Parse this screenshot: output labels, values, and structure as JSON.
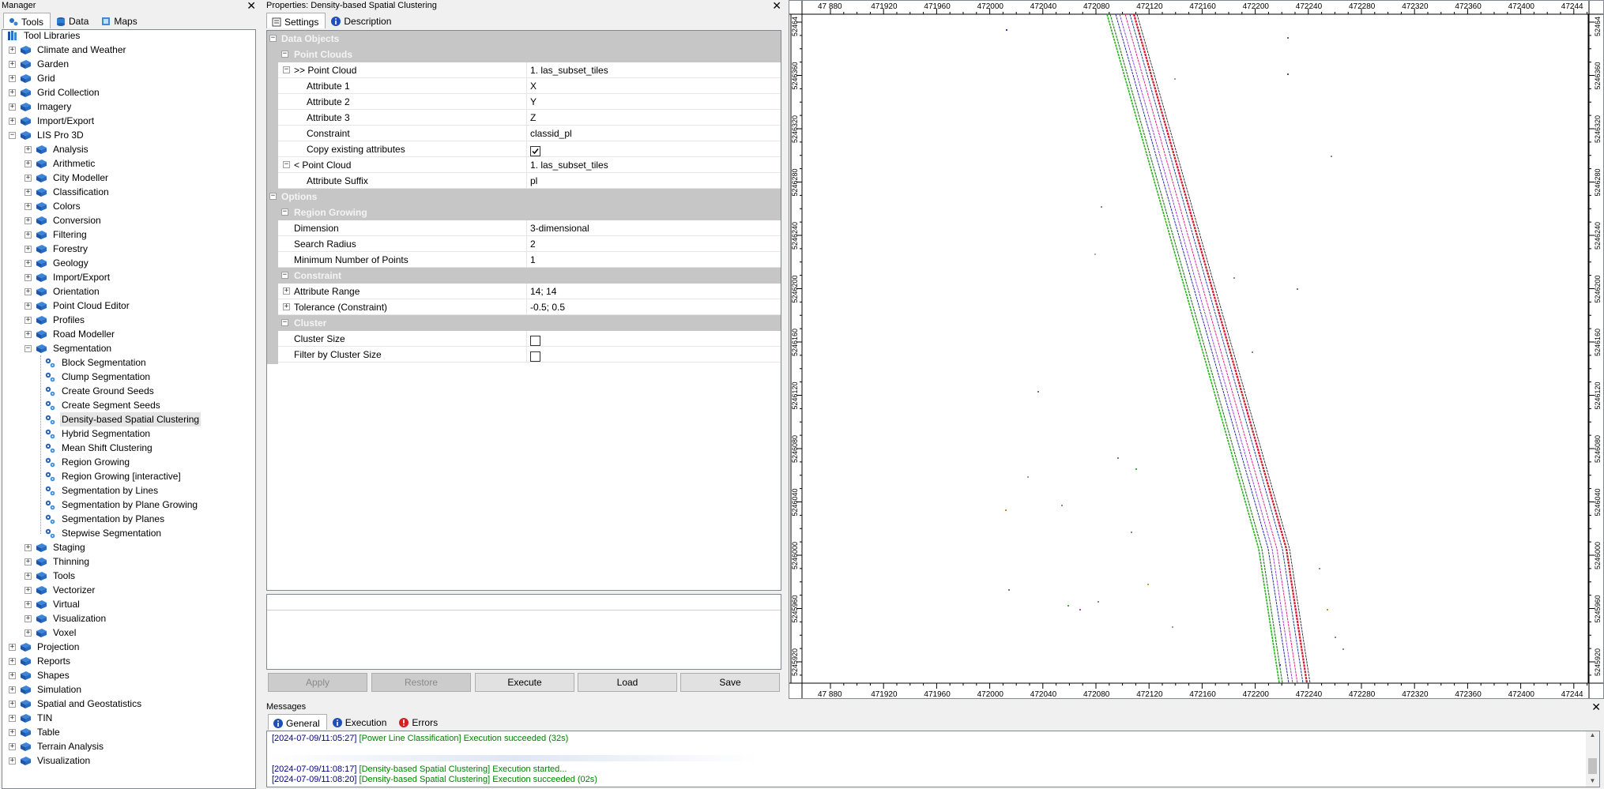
{
  "manager": {
    "title": "Manager",
    "tabs": [
      "Tools",
      "Data",
      "Maps"
    ],
    "tree": [
      {
        "label": "Tool Libraries",
        "level": 0,
        "type": "root",
        "y": 44
      },
      {
        "label": "Climate and Weather",
        "level": 1,
        "exp": "+",
        "y": 62
      },
      {
        "label": "Garden",
        "level": 1,
        "exp": "+",
        "y": 80
      },
      {
        "label": "Grid",
        "level": 1,
        "exp": "+",
        "y": 98
      },
      {
        "label": "Grid Collection",
        "level": 1,
        "exp": "+",
        "y": 116
      },
      {
        "label": "Imagery",
        "level": 1,
        "exp": "+",
        "y": 134
      },
      {
        "label": "Import/Export",
        "level": 1,
        "exp": "+",
        "y": 152
      },
      {
        "label": "LIS Pro 3D",
        "level": 1,
        "exp": "-",
        "y": 170
      },
      {
        "label": "Analysis",
        "level": 2,
        "exp": "+",
        "y": 188
      },
      {
        "label": "Arithmetic",
        "level": 2,
        "exp": "+",
        "y": 206
      },
      {
        "label": "City Modeller",
        "level": 2,
        "exp": "+",
        "y": 224
      },
      {
        "label": "Classification",
        "level": 2,
        "exp": "+",
        "y": 242
      },
      {
        "label": "Colors",
        "level": 2,
        "exp": "+",
        "y": 260
      },
      {
        "label": "Conversion",
        "level": 2,
        "exp": "+",
        "y": 278
      },
      {
        "label": "Filtering",
        "level": 2,
        "exp": "+",
        "y": 296
      },
      {
        "label": "Forestry",
        "level": 2,
        "exp": "+",
        "y": 314
      },
      {
        "label": "Geology",
        "level": 2,
        "exp": "+",
        "y": 332
      },
      {
        "label": "Import/Export",
        "level": 2,
        "exp": "+",
        "y": 350
      },
      {
        "label": "Orientation",
        "level": 2,
        "exp": "+",
        "y": 368
      },
      {
        "label": "Point Cloud Editor",
        "level": 2,
        "exp": "+",
        "y": 386
      },
      {
        "label": "Profiles",
        "level": 2,
        "exp": "+",
        "y": 404
      },
      {
        "label": "Road Modeller",
        "level": 2,
        "exp": "+",
        "y": 422
      },
      {
        "label": "Segmentation",
        "level": 2,
        "exp": "-",
        "y": 440
      },
      {
        "label": "Block Segmentation",
        "level": 3,
        "type": "tool",
        "y": 458
      },
      {
        "label": "Clump Segmentation",
        "level": 3,
        "type": "tool",
        "y": 476
      },
      {
        "label": "Create Ground Seeds",
        "level": 3,
        "type": "tool",
        "y": 494
      },
      {
        "label": "Create Segment Seeds",
        "level": 3,
        "type": "tool",
        "y": 512
      },
      {
        "label": "Density-based Spatial Clustering",
        "level": 3,
        "type": "tool",
        "sel": true,
        "y": 530
      },
      {
        "label": "Hybrid Segmentation",
        "level": 3,
        "type": "tool",
        "y": 548
      },
      {
        "label": "Mean Shift Clustering",
        "level": 3,
        "type": "tool",
        "y": 566
      },
      {
        "label": "Region Growing",
        "level": 3,
        "type": "tool",
        "y": 584
      },
      {
        "label": "Region Growing [interactive]",
        "level": 3,
        "type": "tool",
        "y": 602
      },
      {
        "label": "Segmentation by Lines",
        "level": 3,
        "type": "tool",
        "y": 620
      },
      {
        "label": "Segmentation by Plane Growing",
        "level": 3,
        "type": "tool",
        "y": 638
      },
      {
        "label": "Segmentation by Planes",
        "level": 3,
        "type": "tool",
        "y": 656
      },
      {
        "label": "Stepwise Segmentation",
        "level": 3,
        "type": "tool",
        "y": 674
      },
      {
        "label": "Staging",
        "level": 2,
        "exp": "+",
        "y": 692
      },
      {
        "label": "Thinning",
        "level": 2,
        "exp": "+",
        "y": 710
      },
      {
        "label": "Tools",
        "level": 2,
        "exp": "+",
        "y": 728
      },
      {
        "label": "Vectorizer",
        "level": 2,
        "exp": "+",
        "y": 746
      },
      {
        "label": "Virtual",
        "level": 2,
        "exp": "+",
        "y": 764
      },
      {
        "label": "Visualization",
        "level": 2,
        "exp": "+",
        "y": 782
      },
      {
        "label": "Voxel",
        "level": 2,
        "exp": "+",
        "y": 800
      },
      {
        "label": "Projection",
        "level": 1,
        "exp": "+",
        "y": 818
      },
      {
        "label": "Reports",
        "level": 1,
        "exp": "+",
        "y": 836
      },
      {
        "label": "Shapes",
        "level": 1,
        "exp": "+",
        "y": 854
      },
      {
        "label": "Simulation",
        "level": 1,
        "exp": "+",
        "y": 872
      },
      {
        "label": "Spatial and Geostatistics",
        "level": 1,
        "exp": "+",
        "y": 890
      },
      {
        "label": "TIN",
        "level": 1,
        "exp": "+",
        "y": 908
      },
      {
        "label": "Table",
        "level": 1,
        "exp": "+",
        "y": 926
      },
      {
        "label": "Terrain Analysis",
        "level": 1,
        "exp": "+",
        "y": 944
      },
      {
        "label": "Visualization",
        "level": 1,
        "exp": "+",
        "y": 962
      }
    ]
  },
  "properties": {
    "title": "Properties: Density-based Spatial Clustering",
    "tabs": [
      "Settings",
      "Description"
    ],
    "rows": [
      {
        "kind": "cat",
        "indent": 0,
        "label": "Data Objects",
        "y": 48
      },
      {
        "kind": "cat",
        "indent": 1,
        "label": "Point Clouds",
        "y": 68
      },
      {
        "kind": "prop",
        "indent": 1,
        "exp": "-",
        "label": ">> Point Cloud",
        "value": "1. las_subset_tiles",
        "y": 88
      },
      {
        "kind": "prop",
        "indent": 2,
        "label": "Attribute 1",
        "value": "X",
        "y": 108
      },
      {
        "kind": "prop",
        "indent": 2,
        "label": "Attribute 2",
        "value": "Y",
        "y": 128
      },
      {
        "kind": "prop",
        "indent": 2,
        "label": "Attribute 3",
        "value": "Z",
        "y": 148
      },
      {
        "kind": "prop",
        "indent": 2,
        "label": "Constraint",
        "value": "classid_pl",
        "y": 168
      },
      {
        "kind": "check",
        "indent": 2,
        "label": "Copy existing attributes",
        "checked": true,
        "y": 188
      },
      {
        "kind": "prop",
        "indent": 1,
        "exp": "-",
        "label": "< Point Cloud",
        "value": "1. las_subset_tiles",
        "y": 208
      },
      {
        "kind": "prop",
        "indent": 2,
        "label": "Attribute Suffix",
        "value": "pl",
        "y": 228
      },
      {
        "kind": "cat",
        "indent": 0,
        "label": "Options",
        "y": 248
      },
      {
        "kind": "cat",
        "indent": 1,
        "label": "Region Growing",
        "y": 268
      },
      {
        "kind": "prop",
        "indent": 1,
        "label": "Dimension",
        "value": "3-dimensional",
        "y": 288
      },
      {
        "kind": "prop",
        "indent": 1,
        "label": "Search Radius",
        "value": "2",
        "y": 308
      },
      {
        "kind": "prop",
        "indent": 1,
        "label": "Minimum Number of Points",
        "value": "1",
        "y": 328
      },
      {
        "kind": "cat",
        "indent": 1,
        "label": "Constraint",
        "y": 348
      },
      {
        "kind": "prop",
        "indent": 1,
        "exp": "+",
        "label": "Attribute Range",
        "value": "14; 14",
        "y": 368
      },
      {
        "kind": "prop",
        "indent": 1,
        "exp": "+",
        "label": "Tolerance (Constraint)",
        "value": "-0.5; 0.5",
        "y": 388
      },
      {
        "kind": "cat",
        "indent": 1,
        "label": "Cluster",
        "y": 408
      },
      {
        "kind": "check",
        "indent": 1,
        "label": "Cluster Size",
        "checked": false,
        "y": 428
      },
      {
        "kind": "check",
        "indent": 1,
        "label": "Filter by Cluster Size",
        "checked": false,
        "y": 448
      }
    ],
    "buttons": {
      "apply": "Apply",
      "restore": "Restore",
      "execute": "Execute",
      "load": "Load",
      "save": "Save"
    }
  },
  "map": {
    "x_ticks": [
      "47 880",
      "471920",
      "471960",
      "472000",
      "472040",
      "472080",
      "472120",
      "472160",
      "472200",
      "472240",
      "472280",
      "472320",
      "472360",
      "472400",
      "47244"
    ],
    "y_ticks": [
      "52464",
      "5246360",
      "5246320",
      "5246280",
      "5246240",
      "5246200",
      "5246160",
      "5246120",
      "5246080",
      "5246040",
      "5246000",
      "5245960",
      "5245920"
    ]
  },
  "messages": {
    "title": "Messages",
    "tabs": [
      "General",
      "Execution",
      "Errors"
    ],
    "lines": [
      {
        "ts": "[2024-07-09/11:05:27]",
        "text": "[Power Line Classification] Execution succeeded (32s)"
      },
      {
        "ts": "[2024-07-09/11:08:17]",
        "text": "[Density-based Spatial Clustering] Execution started..."
      },
      {
        "ts": "[2024-07-09/11:08:20]",
        "text": "[Density-based Spatial Clustering] Execution succeeded (02s)"
      }
    ]
  },
  "colors": {
    "accent": "#0078d7",
    "catBg": "#c6c6c6",
    "ts": "#000080",
    "msg": "#008000"
  }
}
